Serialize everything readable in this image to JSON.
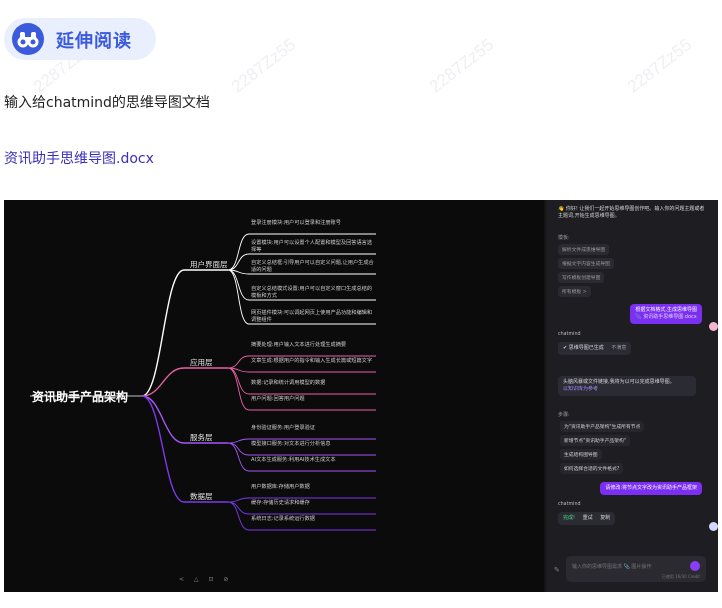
{
  "header": {
    "title": "延伸阅读",
    "icon": "binoculars-icon"
  },
  "watermark": "2287Zz55",
  "intro_text": "输入给chatmind的思维导图文档",
  "doc_link": "资讯助手思维导图.docx",
  "mindmap": {
    "root": "资讯助手产品架构",
    "branches": [
      {
        "label": "用户界面层",
        "color": "#ffffff",
        "leaves": [
          "登录注册模块:用户可以登录和注册账号",
          "设置模块:用户可以设置个人配置和模型及回答语言选择等",
          "自定义总结框:引导用户可以自定义问题,让用户生成合适的问题",
          "自定义总结模式设置:用户可以自定义窗口生成总结的模板和方式",
          "网页插件模块:可以调起网页上使用产品功能和编辑和调整组件"
        ]
      },
      {
        "label": "应用层",
        "color": "#ec5fa4",
        "leaves": [
          "摘要处理:用户输入文本进行处理生成摘要",
          "文章生成:根据用户的指令和输入生成长篇或短篇文字",
          "数据:记录和统计调用模型的数据",
          "用户问题:回答用户问题"
        ]
      },
      {
        "label": "服务层",
        "color": "#a855f7",
        "leaves": [
          "身份验证服务:用户登录验证",
          "模型接口服务:对文本进行分析信息",
          "AI文本生成服务:利用AI技术生成文本"
        ]
      },
      {
        "label": "数据层",
        "color": "#7c3aed",
        "leaves": [
          "用户数据库:存储用户数据",
          "缓存:存储历史请求和缓存",
          "系统日志:记录系统运行数据"
        ]
      }
    ],
    "toolbar_hint": "< △ ⊡ ⊘"
  },
  "chat": {
    "tip": "👋 你好! 让我们一起开始思维导图创作吧。输入你的问题主题或者主题词,开始生成思维导图。",
    "templates_title": "模板:",
    "templates": [
      "解析文件成思维导图",
      "根据文字内容生成导图",
      "写作模板创建导图",
      "所有模板 >"
    ],
    "user_msg1": "根据文档格式,生成思维导图",
    "user_msg1_sub": "📎 资讯助手思维导图.docx",
    "bot_name": "chatmind",
    "bot_status1": "✔ 思维导图已生成",
    "bot_action1": "不满意",
    "bot_msg2": "头脑风暴或文件链接,我将为以可以完成思维导图。",
    "bot_msg2_sub": "以知识库为参考",
    "steps_title": "步骤:",
    "steps": [
      "为\"资讯助手产品架构\"生成所有节点",
      "新增节点\"资讯助手产品架构\"",
      "生成结构图导图",
      "如何选择合适的文件格式?"
    ],
    "user_msg2": "请修改:将节点文字改为资讯助手产品框架",
    "bot_done": "完成!",
    "bot_actions2": [
      "重试",
      "复制"
    ],
    "input_placeholder": "输入你的思维导图需求 📎 图片操作",
    "input_counter": "已使用 16/30 Credit"
  },
  "colors": {
    "accent": "#3b5bdb",
    "link": "#3a2fb8",
    "purple": "#7b2ff2"
  }
}
